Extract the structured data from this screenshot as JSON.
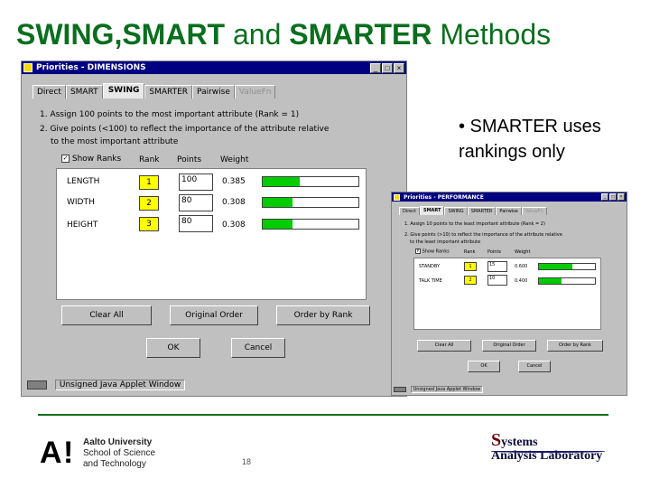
{
  "slide": {
    "title_bold1": "SWING,SMART",
    "title_mid": " and ",
    "title_bold2": "SMARTER",
    "title_end": " Methods",
    "bullet": "• SMARTER uses rankings only",
    "page_number": "18"
  },
  "main_window": {
    "title": "Priorities - DIMENSIONS",
    "tabs": [
      "Direct",
      "SMART",
      "SWING",
      "SMARTER",
      "Pairwise",
      "ValueFn"
    ],
    "active_tab": "SWING",
    "instruction1": "1. Assign 100 points to the most important attribute (Rank = 1)",
    "instruction2a": "2. Give points (<100) to reflect the importance of the attribute relative",
    "instruction2b": "to the most important attribute",
    "show_ranks_label": "Show Ranks",
    "show_ranks_checked": "✓",
    "col_rank": "Rank",
    "col_points": "Points",
    "col_weight": "Weight",
    "rows": [
      {
        "attr": "LENGTH",
        "rank": "1",
        "points": "100",
        "weight": "0.385",
        "weight_value": 0.385
      },
      {
        "attr": "WIDTH",
        "rank": "2",
        "points": "80",
        "weight": "0.308",
        "weight_value": 0.308
      },
      {
        "attr": "HEIGHT",
        "rank": "3",
        "points": "80",
        "weight": "0.308",
        "weight_value": 0.308
      }
    ],
    "btn_clear": "Clear All",
    "btn_original": "Original Order",
    "btn_order_rank": "Order by Rank",
    "btn_ok": "OK",
    "btn_cancel": "Cancel",
    "status": "Unsigned Java Applet Window"
  },
  "second_window": {
    "title": "Priorities - PERFORMANCE",
    "tabs": [
      "Direct",
      "SMART",
      "SWING",
      "SMARTER",
      "Pairwise",
      "ValueFn"
    ],
    "active_tab": "SMART",
    "instruction1": "1. Assign 10 points to the least important attribute (Rank = 2)",
    "instruction2a": "2. Give points (>10) to reflect the importance of the attribute relative",
    "instruction2b": "to the least important attribute",
    "show_ranks_label": "Show Ranks",
    "show_ranks_checked": "P",
    "col_rank": "Rank",
    "col_points": "Points",
    "col_weight": "Weight",
    "rows": [
      {
        "attr": "STANDBY",
        "rank": "1",
        "points": "15",
        "weight": "0.600",
        "weight_value": 0.6
      },
      {
        "attr": "TALK TIME",
        "rank": "2",
        "points": "10",
        "weight": "0.400",
        "weight_value": 0.4
      }
    ],
    "btn_clear": "Clear All",
    "btn_original": "Original Order",
    "btn_order_rank": "Order by Rank",
    "btn_ok": "OK",
    "btn_cancel": "Cancel",
    "status": "Unsigned Java Applet Window"
  },
  "footer": {
    "aalto_line1": "Aalto University",
    "aalto_line2": "School of Science",
    "aalto_line3": "and Technology",
    "sal_big": "S",
    "sal_line1_rest": "ystems",
    "sal_line2": "Analysis Laboratory"
  },
  "colors": {
    "title_green": "#0a6e1e",
    "bar_green": "#00cc00",
    "rank_yellow": "#ffff00",
    "titlebar_navy": "#000080"
  }
}
